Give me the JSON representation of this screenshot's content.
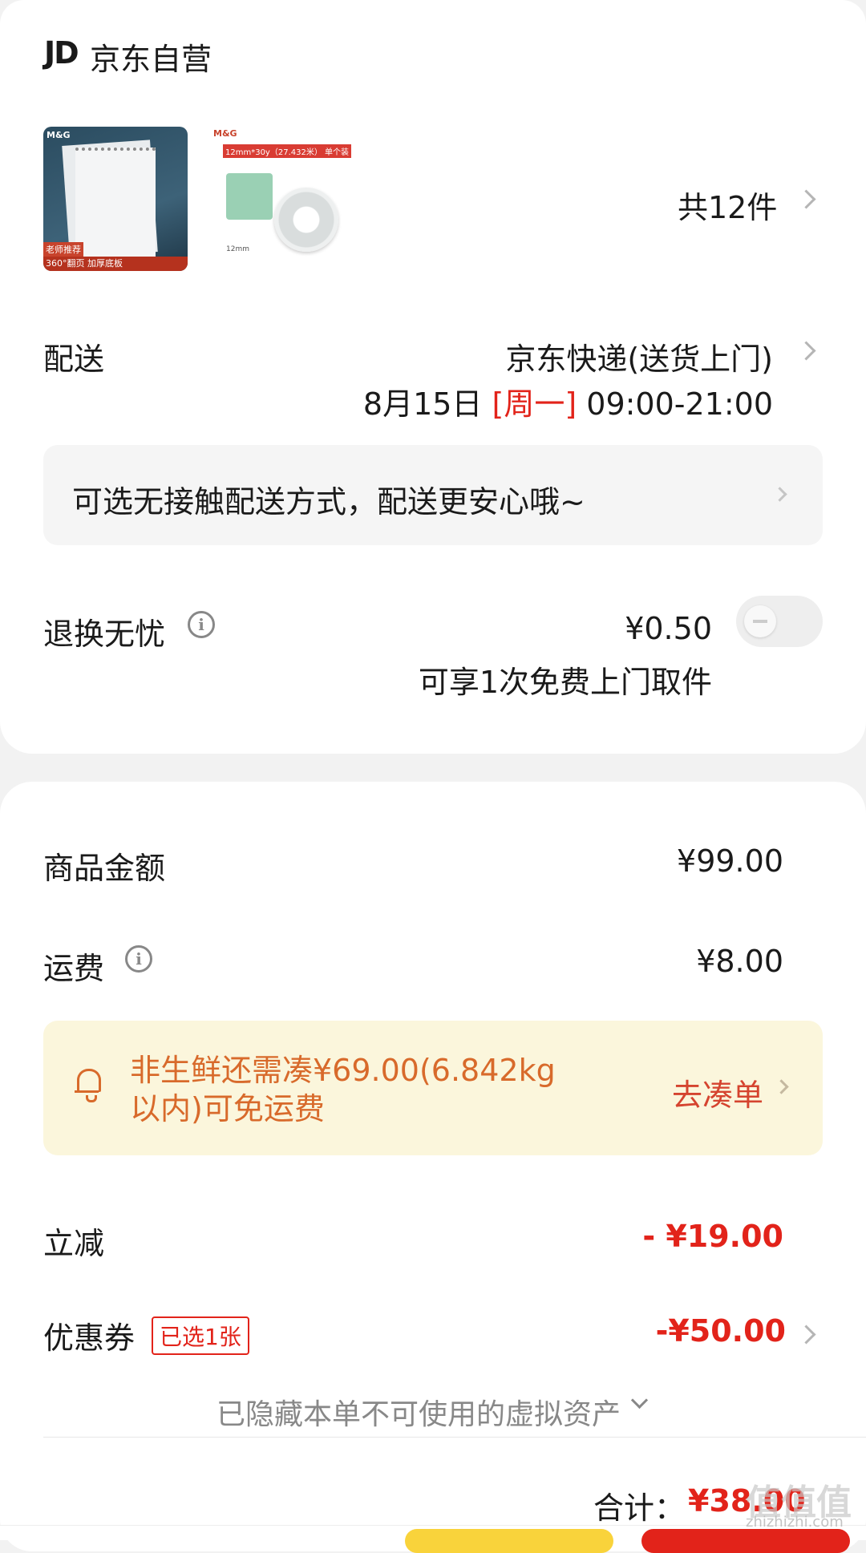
{
  "shop": {
    "logo": "JD",
    "name": "京东自营"
  },
  "products": {
    "thumb1": {
      "brand": "M&G",
      "badge_top": "老师推荐",
      "badge_bottom": "360°翻页 加厚底板"
    },
    "thumb2": {
      "brand": "M&G",
      "spec": "12mm*30y（27.432米）",
      "pack": "单个装",
      "size": "12mm"
    },
    "count_label": "共12件"
  },
  "delivery": {
    "label": "配送",
    "method": "京东快递(送货上门)",
    "date": "8月15日",
    "weekday": "[周一]",
    "time": "09:00-21:00",
    "contactless": "可选无接触配送方式，配送更安心哦~"
  },
  "return_service": {
    "label": "退换无忧",
    "price": "¥0.50",
    "desc": "可享1次免费上门取件"
  },
  "summary": {
    "goods_label": "商品金额",
    "goods_amount": "¥99.00",
    "shipping_label": "运费",
    "shipping_amount": "¥8.00",
    "free_ship_tip": "非生鲜还需凑¥69.00(6.842kg以内)可免运费",
    "free_ship_action": "去凑单",
    "discount_label": "立减",
    "discount_amount": "- ¥19.00",
    "coupon_label": "优惠券",
    "coupon_badge": "已选1张",
    "coupon_amount": "-¥50.00",
    "hidden_assets": "已隐藏本单不可使用的虚拟资产",
    "total_label": "合计：",
    "total_amount": "¥38.00"
  },
  "watermark": {
    "text": "zhizhizhi.com",
    "logo": "值值值"
  },
  "colors": {
    "accent_red": "#e2231a",
    "tip_bg": "#fbf6dc",
    "tip_text": "#d86a2b"
  }
}
